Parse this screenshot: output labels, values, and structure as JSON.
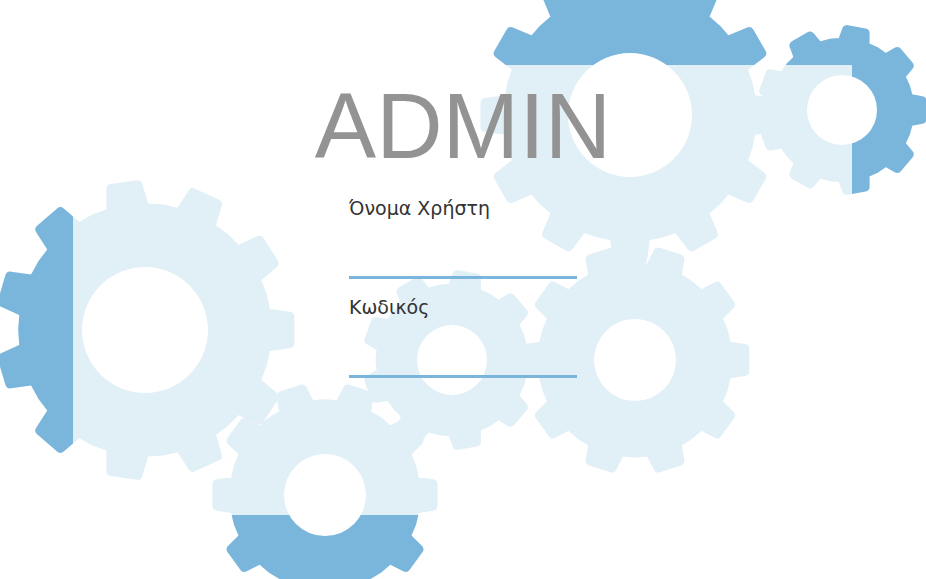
{
  "title": "ADMIN",
  "fields": [
    {
      "label": "Όνομα Χρήστη"
    },
    {
      "label": "Κωδικός"
    }
  ]
}
